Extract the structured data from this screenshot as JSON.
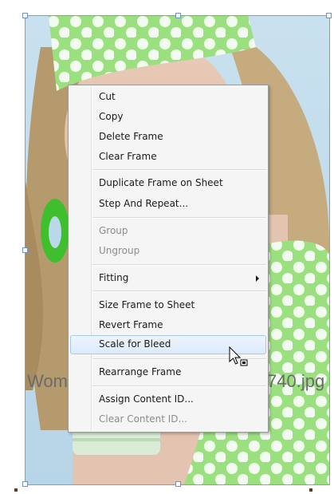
{
  "frame": {
    "filename_left": "Wom",
    "filename_right": "740.jpg"
  },
  "context_menu": {
    "groups": [
      [
        {
          "id": "cut",
          "label": "Cut",
          "enabled": true
        },
        {
          "id": "copy",
          "label": "Copy",
          "enabled": true
        },
        {
          "id": "delete-frame",
          "label": "Delete Frame",
          "enabled": true
        },
        {
          "id": "clear-frame",
          "label": "Clear Frame",
          "enabled": true
        }
      ],
      [
        {
          "id": "duplicate-frame-on-sheet",
          "label": "Duplicate Frame on Sheet",
          "enabled": true
        },
        {
          "id": "step-and-repeat",
          "label": "Step And Repeat...",
          "enabled": true
        }
      ],
      [
        {
          "id": "group",
          "label": "Group",
          "enabled": false
        },
        {
          "id": "ungroup",
          "label": "Ungroup",
          "enabled": false
        }
      ],
      [
        {
          "id": "fitting",
          "label": "Fitting",
          "enabled": true,
          "submenu": true
        }
      ],
      [
        {
          "id": "size-frame-to-sheet",
          "label": "Size Frame to Sheet",
          "enabled": true
        },
        {
          "id": "revert-frame",
          "label": "Revert Frame",
          "enabled": true
        },
        {
          "id": "scale-for-bleed",
          "label": "Scale for Bleed",
          "enabled": true,
          "highlighted": true
        }
      ],
      [
        {
          "id": "rearrange-frame",
          "label": "Rearrange Frame",
          "enabled": true
        }
      ],
      [
        {
          "id": "assign-content-id",
          "label": "Assign Content ID...",
          "enabled": true
        },
        {
          "id": "clear-content-id",
          "label": "Clear Content ID...",
          "enabled": false
        }
      ]
    ]
  },
  "icons": {
    "submenu_arrow": "chevron-right-icon",
    "cursor": "pointer-copy-cursor-icon"
  },
  "colors": {
    "menu_bg": "#f5f5f5",
    "highlight_border": "#a8c8ec",
    "disabled_text": "#8c8c8c",
    "frame_border": "#7a9fd6"
  }
}
